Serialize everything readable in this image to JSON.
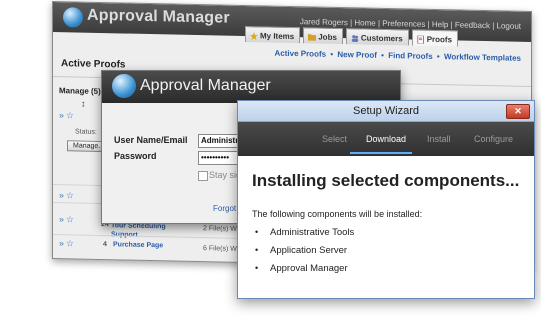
{
  "app": {
    "title": "Approval Manager",
    "user_bar": "Jared Rogers | Home | Preferences | Help | Feedback | Logout",
    "tabs": [
      {
        "label": "My Items",
        "icon": "star-icon"
      },
      {
        "label": "Jobs",
        "icon": "folder-icon"
      },
      {
        "label": "Customers",
        "icon": "people-icon"
      },
      {
        "label": "Proofs",
        "icon": "document-icon"
      }
    ],
    "links": [
      "Active Proofs",
      "New Proof",
      "Find Proofs",
      "Workflow Templates"
    ],
    "link_separator": "•",
    "section_title": "Active Proofs",
    "grid_header": "Manage (5)",
    "status_label": "Status:",
    "manage_button": "Manage...",
    "rows": [
      {
        "num": "24",
        "name": "Tour Scheduling Support",
        "files": "2 File(s) Wai"
      },
      {
        "num": "4",
        "name": "Purchase Page",
        "files": "6 File(s) Wai"
      }
    ]
  },
  "login": {
    "title": "Approval Manager",
    "username_label": "User Name/Email",
    "username_value": "Administrator",
    "password_label": "Password",
    "password_value": "••••••••••",
    "stay_signed_in": "Stay signed in",
    "forgot_link": "Forgot your password?"
  },
  "wizard": {
    "title": "Setup Wizard",
    "close_glyph": "✕",
    "steps": [
      "Select",
      "Download",
      "Install",
      "Configure"
    ],
    "active_step": "Download",
    "heading": "Installing selected components...",
    "description": "The following components will be installed:",
    "components": [
      "Administrative Tools",
      "Application Server",
      "Approval Manager"
    ]
  },
  "colors": {
    "accent_link": "#2a5da8",
    "dark_header": "#3c3c3c",
    "active_step_underline": "#5ab0ff",
    "close_button": "#c43a23"
  }
}
